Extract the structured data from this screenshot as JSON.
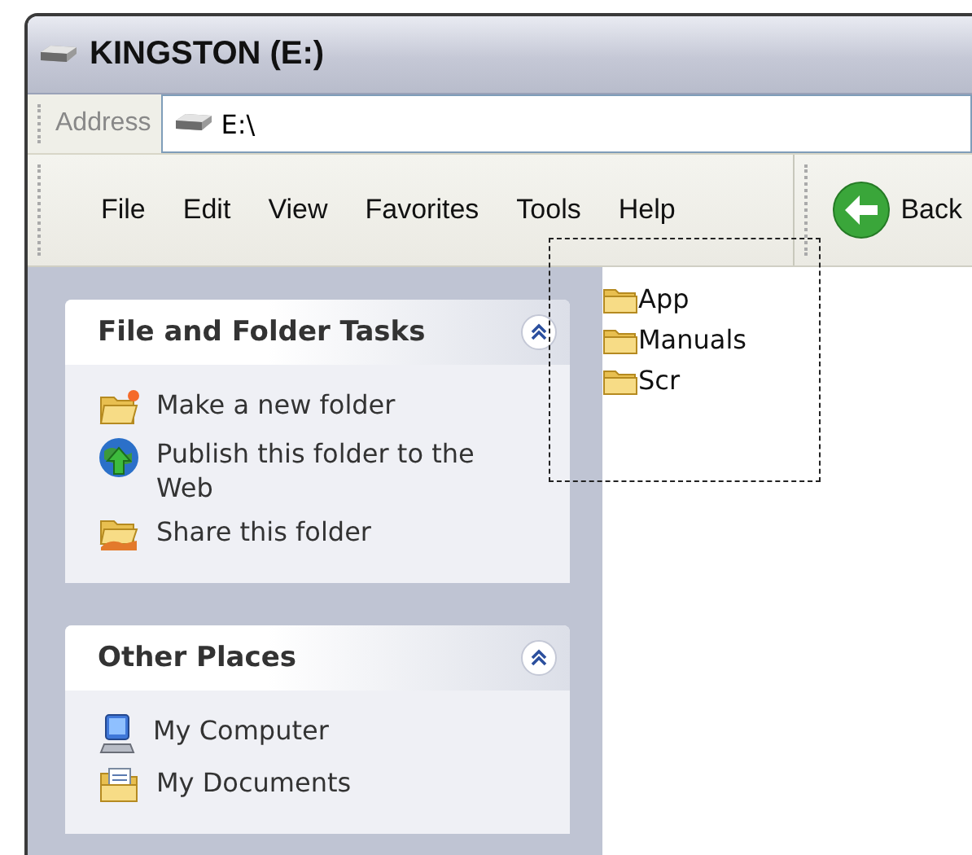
{
  "window": {
    "title": "KINGSTON (E:)"
  },
  "address_bar": {
    "label": "Address",
    "value": "E:\\"
  },
  "menu": [
    "File",
    "Edit",
    "View",
    "Favorites",
    "Tools",
    "Help"
  ],
  "toolbar": {
    "back": "Back"
  },
  "task_panels": [
    {
      "title": "File and Folder Tasks",
      "expanded": true,
      "items": [
        {
          "label": "Make a new folder",
          "kind": "new-folder"
        },
        {
          "label": "Publish this folder to the Web",
          "kind": "publish"
        },
        {
          "label": "Share this folder",
          "kind": "share"
        }
      ]
    },
    {
      "title": "Other Places",
      "expanded": true,
      "items": [
        {
          "label": "My Computer",
          "kind": "computer"
        },
        {
          "label": "My Documents",
          "kind": "documents"
        }
      ]
    }
  ],
  "files": [
    {
      "name": "App"
    },
    {
      "name": "Manuals"
    },
    {
      "name": "Scr"
    }
  ]
}
